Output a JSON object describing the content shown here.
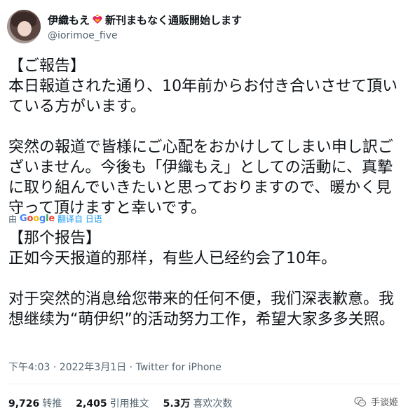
{
  "user": {
    "display_name": "伊織もえ",
    "name_suffix": "新刊まもなく通販開始します",
    "handle": "@iorimoe_five",
    "heart_icon": "heart-on-fire-icon"
  },
  "tweet": {
    "japanese_text": "【ご報告】\n本日報道された通り、10年前からお付き合いさせて頂いている方がいます。\n\n突然の報道で皆様にご心配をおかけしてしまい申し訳ございません。今後も「伊織もえ」としての活動に、真摯に取り組んでいきたいと思っておりますので、暖かく見守って頂けますと幸いです。",
    "translation": {
      "by": "由",
      "google": [
        "G",
        "o",
        "o",
        "g",
        "l",
        "e"
      ],
      "label": "翻译自 日语"
    },
    "chinese_text": "【那个报告】\n正如今天报道的那样，有些人已经约会了10年。\n\n对于突然的消息给您带来的任何不便，我们深表歉意。我想继续为“萌伊织”的活动努力工作，希望大家多多关照。",
    "timestamp": "下午4:03 · 2022年3月1日 · Twitter for iPhone"
  },
  "stats": {
    "retweets": {
      "count": "9,726",
      "label": "转推"
    },
    "quotes": {
      "count": "2,405",
      "label": "引用推文"
    },
    "likes": {
      "count": "5.3万",
      "label": "喜欢次数"
    }
  },
  "watermark": {
    "label": "手谈姬",
    "icon": "wechat-icon"
  },
  "colors": {
    "link": "#1d9bf0",
    "secondary_text": "#536471",
    "primary_text": "#0f1419"
  }
}
